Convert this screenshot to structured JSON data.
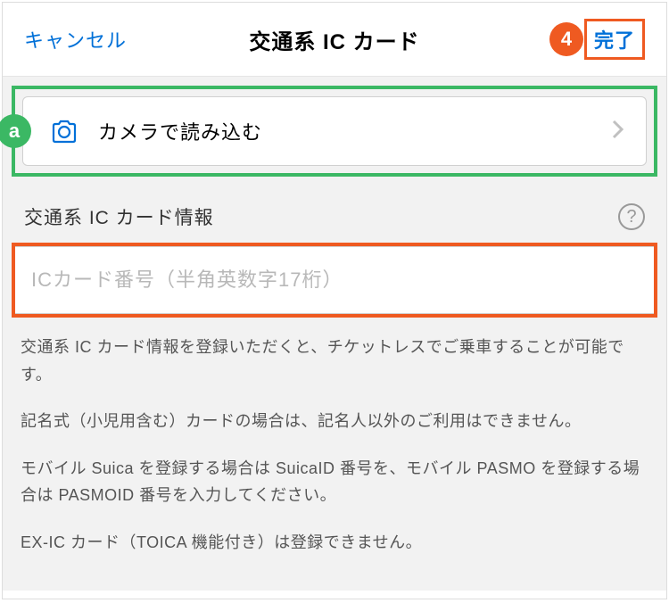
{
  "header": {
    "cancel": "キャンセル",
    "title": "交通系 IC カード",
    "done": "完了"
  },
  "annotations": {
    "step_number": "4",
    "camera_marker": "a"
  },
  "camera": {
    "label": "カメラで読み込む"
  },
  "section": {
    "title": "交通系 IC カード情報",
    "help": "?"
  },
  "input": {
    "placeholder": "ICカード番号（半角英数字17桁）",
    "value": ""
  },
  "description": {
    "para1": "交通系 IC カード情報を登録いただくと、チケットレスでご乗車することが可能です。",
    "para2": "記名式（小児用含む）カードの場合は、記名人以外のご利用はできません。",
    "para3": "モバイル Suica を登録する場合は SuicaID 番号を、モバイル PASMO を登録する場合は PASMOID 番号を入力してください。",
    "para4": "EX-IC カード（TOICA 機能付き）は登録できません。"
  }
}
